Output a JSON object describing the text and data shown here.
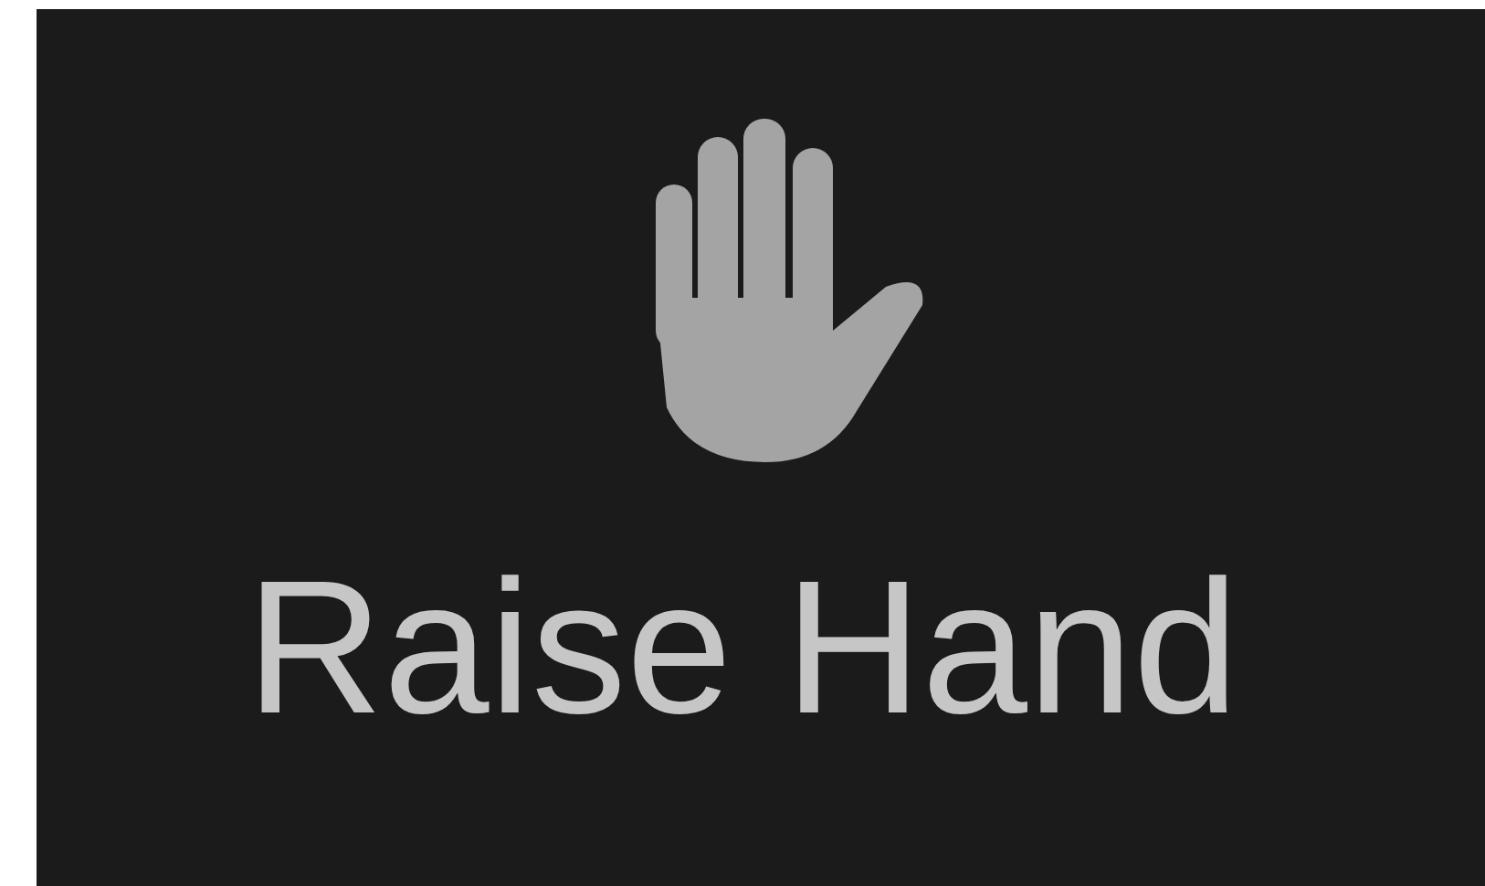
{
  "button": {
    "label": "Raise Hand"
  }
}
